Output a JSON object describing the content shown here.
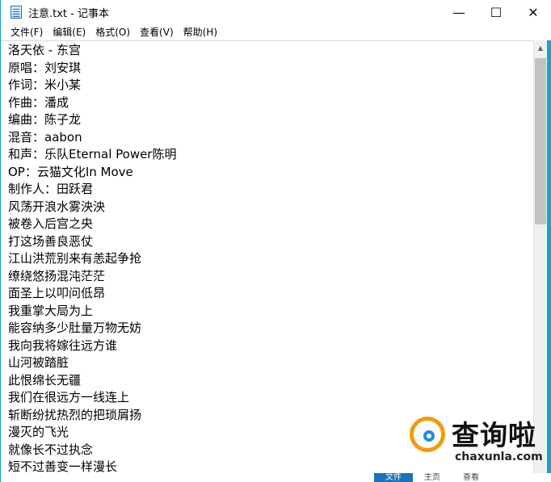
{
  "window": {
    "title": "注意.txt - 记事本",
    "controls": {
      "minimize": "—",
      "maximize": "☐",
      "close": "✕"
    }
  },
  "menu": [
    {
      "label": "文件(F)"
    },
    {
      "label": "编辑(E)"
    },
    {
      "label": "格式(O)"
    },
    {
      "label": "查看(V)"
    },
    {
      "label": "帮助(H)"
    }
  ],
  "content": {
    "lines": [
      "洛天依 - 东宫",
      "原唱：刘安琪",
      "作词：米小某",
      "作曲：潘成",
      "编曲：陈子龙",
      "混音：aabon",
      "和声：乐队Eternal Power陈明",
      "OP：云猫文化In Move",
      "制作人：田跃君",
      "风荡开浪水雾泱泱",
      "被卷入后宫之央",
      "打这场善良恶仗",
      "江山洪荒别来有恙起争抢",
      "缭绕悠扬混沌茫茫",
      "面圣上以叩问低昂",
      "我重掌大局为上",
      "能容纳多少肚量万物无妨",
      "我向我将嫁往远方谁",
      "山河被踏脏",
      "此恨绵长无疆",
      "我们在很远方一线连上",
      "斩断纷扰热烈的把琐屑扬",
      "漫灭的飞光",
      "就像长不过执念",
      "短不过善变一样漫长"
    ]
  },
  "scrollbar": {
    "up_arrow": "▲"
  },
  "taskbar_peek": {
    "tabs": [
      "文件",
      "主页",
      "查看"
    ]
  },
  "watermark": {
    "cn": "查询啦",
    "en": "chaxunla.com"
  },
  "colors": {
    "accent": "#1aa3c4",
    "watermark_orange": "#f29b10",
    "watermark_blue": "#1e8de0"
  }
}
